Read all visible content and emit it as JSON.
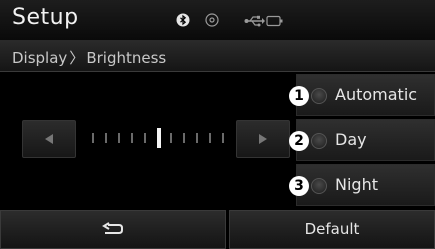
{
  "header": {
    "title": "Setup",
    "status_icons": [
      "bluetooth-icon",
      "disc-icon",
      "usb-icon",
      "battery-icon"
    ]
  },
  "breadcrumb": {
    "parent": "Display",
    "separator": "〉",
    "current": "Brightness"
  },
  "brightness_slider": {
    "tick_count": 11,
    "selected_index": 5,
    "left_arrow_icon": "left-arrow-icon",
    "right_arrow_icon": "right-arrow-icon"
  },
  "options": [
    {
      "number": "1",
      "label": "Automatic"
    },
    {
      "number": "2",
      "label": "Day"
    },
    {
      "number": "3",
      "label": "Night"
    }
  ],
  "footer": {
    "back_icon": "back-icon",
    "default_label": "Default"
  },
  "colors": {
    "background": "#000000",
    "text": "#ffffff",
    "button": "#262626"
  }
}
